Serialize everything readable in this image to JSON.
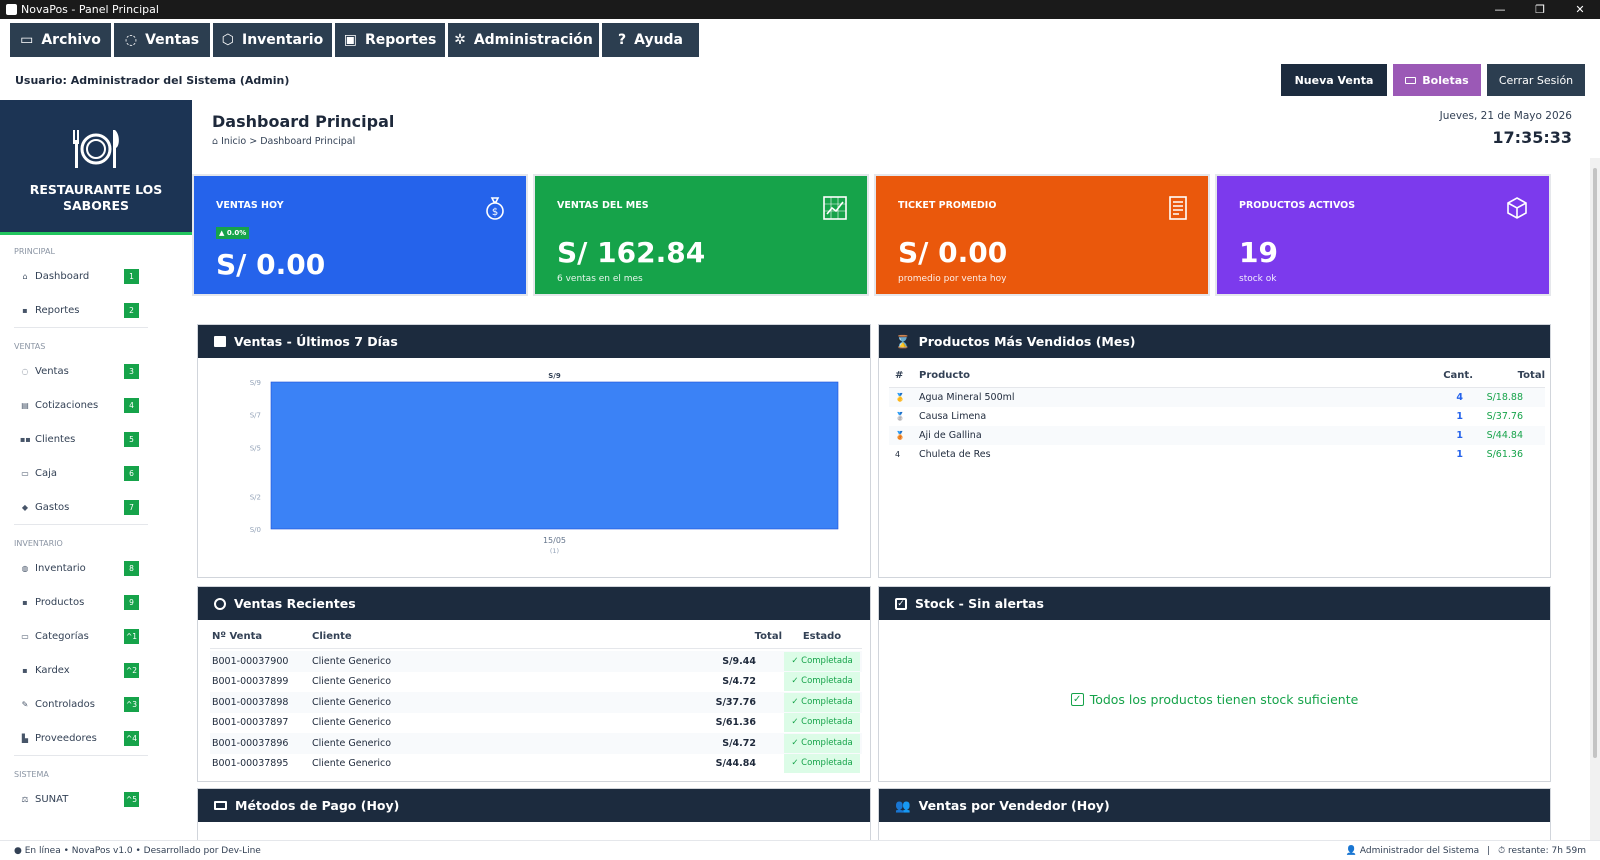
{
  "window": {
    "title": "NovaPos - Panel Principal",
    "minimize": "—",
    "maximize": "❐",
    "close": "✕"
  },
  "menu": [
    {
      "label": "Archivo",
      "icon": "folder-icon",
      "width": 101
    },
    {
      "label": "Ventas",
      "icon": "money-bag-icon",
      "width": 96
    },
    {
      "label": "Inventario",
      "icon": "box-icon",
      "width": 119
    },
    {
      "label": "Reportes",
      "icon": "chart-icon",
      "width": 110
    },
    {
      "label": "Administración",
      "icon": "gear-icon",
      "width": 151
    },
    {
      "label": "Ayuda",
      "icon": "help-icon",
      "width": 97
    }
  ],
  "user_label": "Usuario: Administrador del Sistema (Admin)",
  "top_buttons": {
    "new_sale": "Nueva Venta",
    "receipts": "Boletas",
    "logout": "Cerrar Sesión"
  },
  "brand": {
    "name": "RESTAURANTE LOS SABORES",
    "icon": "plate-cutlery-icon"
  },
  "sidebar": [
    {
      "section": "PRINCIPAL",
      "items": [
        {
          "label": "Dashboard",
          "badge": "1",
          "icon": "⌂"
        },
        {
          "label": "Reportes",
          "badge": "2",
          "icon": "▪"
        }
      ]
    },
    {
      "section": "VENTAS",
      "items": [
        {
          "label": "Ventas",
          "badge": "3",
          "icon": "◌"
        },
        {
          "label": "Cotizaciones",
          "badge": "4",
          "icon": "▤"
        },
        {
          "label": "Clientes",
          "badge": "5",
          "icon": "▪▪"
        },
        {
          "label": "Caja",
          "badge": "6",
          "icon": "▭"
        },
        {
          "label": "Gastos",
          "badge": "7",
          "icon": "◆"
        }
      ]
    },
    {
      "section": "INVENTARIO",
      "items": [
        {
          "label": "Inventario",
          "badge": "8",
          "icon": "◍"
        },
        {
          "label": "Productos",
          "badge": "9",
          "icon": "▪"
        },
        {
          "label": "Categorías",
          "badge": "^1",
          "icon": "▭"
        },
        {
          "label": "Kardex",
          "badge": "^2",
          "icon": "▪"
        },
        {
          "label": "Controlados",
          "badge": "^3",
          "icon": "✎"
        },
        {
          "label": "Proveedores",
          "badge": "^4",
          "icon": "▙"
        }
      ]
    },
    {
      "section": "SISTEMA",
      "items": [
        {
          "label": "SUNAT",
          "badge": "^5",
          "icon": "⚖"
        }
      ]
    }
  ],
  "page": {
    "title": "Dashboard Principal",
    "breadcrumb": "Inicio > Dashboard Principal",
    "date": "Jueves, 21 de Mayo 2026",
    "time": "17:35:33"
  },
  "stats": [
    {
      "label": "VENTAS HOY",
      "value": "S/ 0.00",
      "sub": "",
      "trend": "▲ 0.0%",
      "color": "#2563eb",
      "icon": "money-bag-icon"
    },
    {
      "label": "VENTAS DEL MES",
      "value": "S/ 162.84",
      "sub": "6 ventas en el mes",
      "trend": "",
      "color": "#16a34a",
      "icon": "chart-icon"
    },
    {
      "label": "TICKET PROMEDIO",
      "value": "S/ 0.00",
      "sub": "promedio por venta hoy",
      "trend": "",
      "color": "#ea580c",
      "icon": "receipt-icon"
    },
    {
      "label": "PRODUCTOS ACTIVOS",
      "value": "19",
      "sub": "stock ok",
      "trend": "",
      "color": "#7c3aed",
      "icon": "box-icon"
    }
  ],
  "panels": {
    "sales7": "Ventas - Últimos 7 Días",
    "top_products": "Productos Más Vendidos (Mes)",
    "recent": "Ventas Recientes",
    "stock": "Stock - Sin alertas",
    "payments": "Métodos de Pago (Hoy)",
    "by_seller": "Ventas por Vendedor (Hoy)"
  },
  "chart_data": {
    "type": "bar",
    "categories": [
      "15/05"
    ],
    "category_sublabels": [
      "(1)"
    ],
    "values": [
      9
    ],
    "data_labels": [
      "S/9"
    ],
    "yticks": [
      "S/0",
      "S/2",
      "S/5",
      "S/7",
      "S/9"
    ],
    "ylim": [
      0,
      9
    ],
    "title": "",
    "xlabel": "",
    "ylabel": "",
    "bar_color": "#3b82f6"
  },
  "top_products": {
    "headers": [
      "#",
      "Producto",
      "Cant.",
      "Total"
    ],
    "rows": [
      {
        "rank": "🥇",
        "name": "Agua Mineral 500ml",
        "qty": "4",
        "total": "S/18.88"
      },
      {
        "rank": "🥈",
        "name": "Causa Limena",
        "qty": "1",
        "total": "S/37.76"
      },
      {
        "rank": "🥉",
        "name": "Aji de Gallina",
        "qty": "1",
        "total": "S/44.84"
      },
      {
        "rank": "4",
        "name": "Chuleta de Res",
        "qty": "1",
        "total": "S/61.36"
      }
    ]
  },
  "recent_sales": {
    "headers": [
      "Nº Venta",
      "Cliente",
      "Total",
      "Estado"
    ],
    "rows": [
      {
        "num": "B001-00037900",
        "client": "Cliente Generico",
        "total": "S/9.44",
        "status": "✓ Completada"
      },
      {
        "num": "B001-00037899",
        "client": "Cliente Generico",
        "total": "S/4.72",
        "status": "✓ Completada"
      },
      {
        "num": "B001-00037898",
        "client": "Cliente Generico",
        "total": "S/37.76",
        "status": "✓ Completada"
      },
      {
        "num": "B001-00037897",
        "client": "Cliente Generico",
        "total": "S/61.36",
        "status": "✓ Completada"
      },
      {
        "num": "B001-00037896",
        "client": "Cliente Generico",
        "total": "S/4.72",
        "status": "✓ Completada"
      },
      {
        "num": "B001-00037895",
        "client": "Cliente Generico",
        "total": "S/44.84",
        "status": "✓ Completada"
      }
    ]
  },
  "stock_message": "Todos los productos tienen stock suficiente",
  "statusbar": {
    "left": "● En línea  •  NovaPos v1.0  •  Desarrollado por Dev-Line",
    "user": "👤 Administrador del Sistema",
    "session": "⏱ restante: 7h 59m"
  }
}
